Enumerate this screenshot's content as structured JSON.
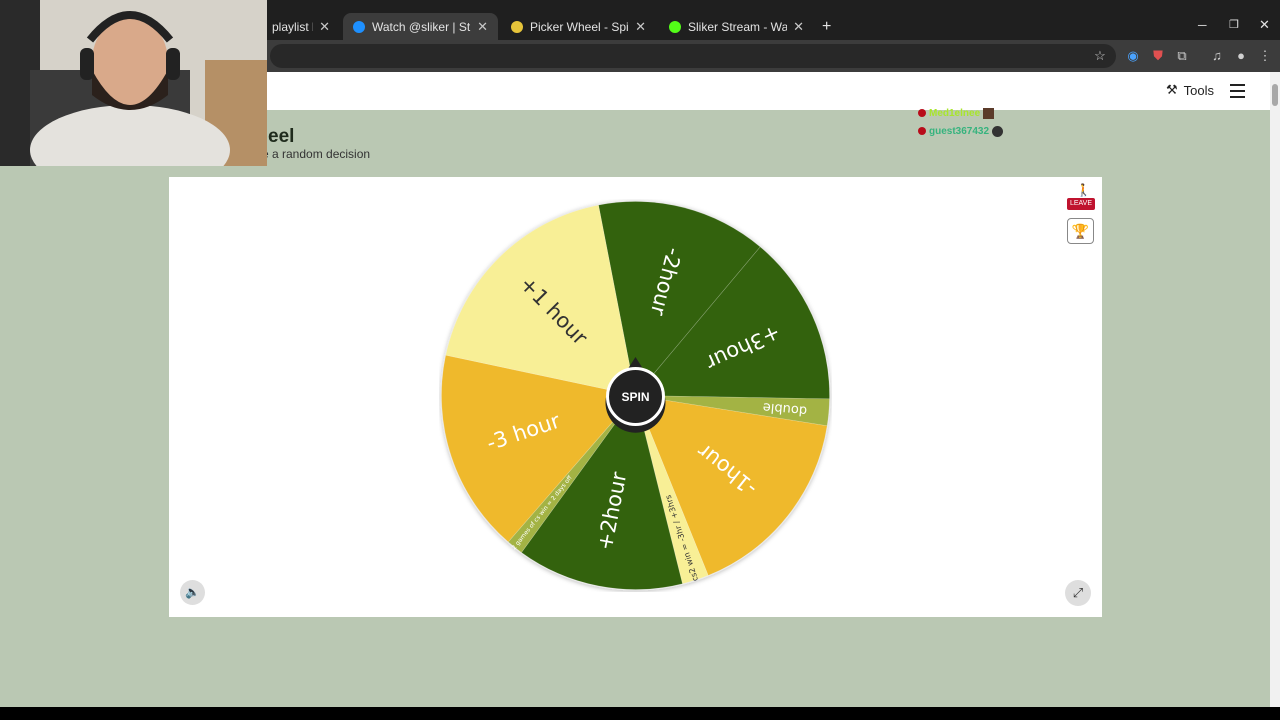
{
  "browser": {
    "tabs": [
      {
        "title": "playlist by its",
        "favicon_color": "#2d2d2d",
        "active": false
      },
      {
        "title": "Watch @sliker | Streamable",
        "favicon_color": "#1e90ff",
        "active": true
      },
      {
        "title": "Picker Wheel - Spin the Wheel t",
        "favicon_color": "#e6c43a",
        "active": false
      },
      {
        "title": "Sliker Stream - Watch Live on K",
        "favicon_color": "#53fc18",
        "active": false
      }
    ],
    "close_glyph": "✕",
    "new_tab_glyph": "+",
    "toolbar_icons": [
      "bookmark-star-icon",
      "audio-icon",
      "extension-icon",
      "puzzle-icon",
      "media-icon",
      "profile-icon",
      "kebab-menu-icon"
    ]
  },
  "site": {
    "tools_label": "Tools",
    "title": "eel",
    "subtitle": "ke a random decision"
  },
  "presence": {
    "users": [
      {
        "name": "Med1elnee",
        "color": "#a8e62b"
      },
      {
        "name": "guest367432",
        "color": "#36b37e"
      }
    ]
  },
  "wheel": {
    "center_label": "SPIN",
    "segments": [
      {
        "label": "-2hour",
        "color": "#33620d",
        "text_color": "#ffffff",
        "sweep_deg": 51
      },
      {
        "label": "+3hour",
        "color": "#33620d",
        "text_color": "#ffffff",
        "sweep_deg": 51
      },
      {
        "label": "double",
        "color": "#a3b344",
        "text_color": "#ffffff",
        "sweep_deg": 8
      },
      {
        "label": "-1hour",
        "color": "#efb92c",
        "text_color": "#ffffff",
        "sweep_deg": 59
      },
      {
        "label": "cs2 win = -3hr / +3hrs",
        "color": "#f8ef96",
        "text_color": "#333333",
        "sweep_deg": 8
      },
      {
        "label": "+2hour",
        "color": "#33620d",
        "text_color": "#ffffff",
        "sweep_deg": 50
      },
      {
        "label": "2 games of cs win = 2 days off",
        "color": "#a3b344",
        "text_color": "#ffffff",
        "sweep_deg": 5
      },
      {
        "label": "-3 hour",
        "color": "#efb92c",
        "text_color": "#ffffff",
        "sweep_deg": 61
      },
      {
        "label": "+1 hour",
        "color": "#f8ef96",
        "text_color": "#333333",
        "sweep_deg": 67
      }
    ]
  },
  "controls": {
    "leave_label": "LEAVE",
    "trophy_icon": "trophy-icon",
    "sound_icon": "speaker-icon",
    "fullscreen_icon": "expand-icon"
  }
}
